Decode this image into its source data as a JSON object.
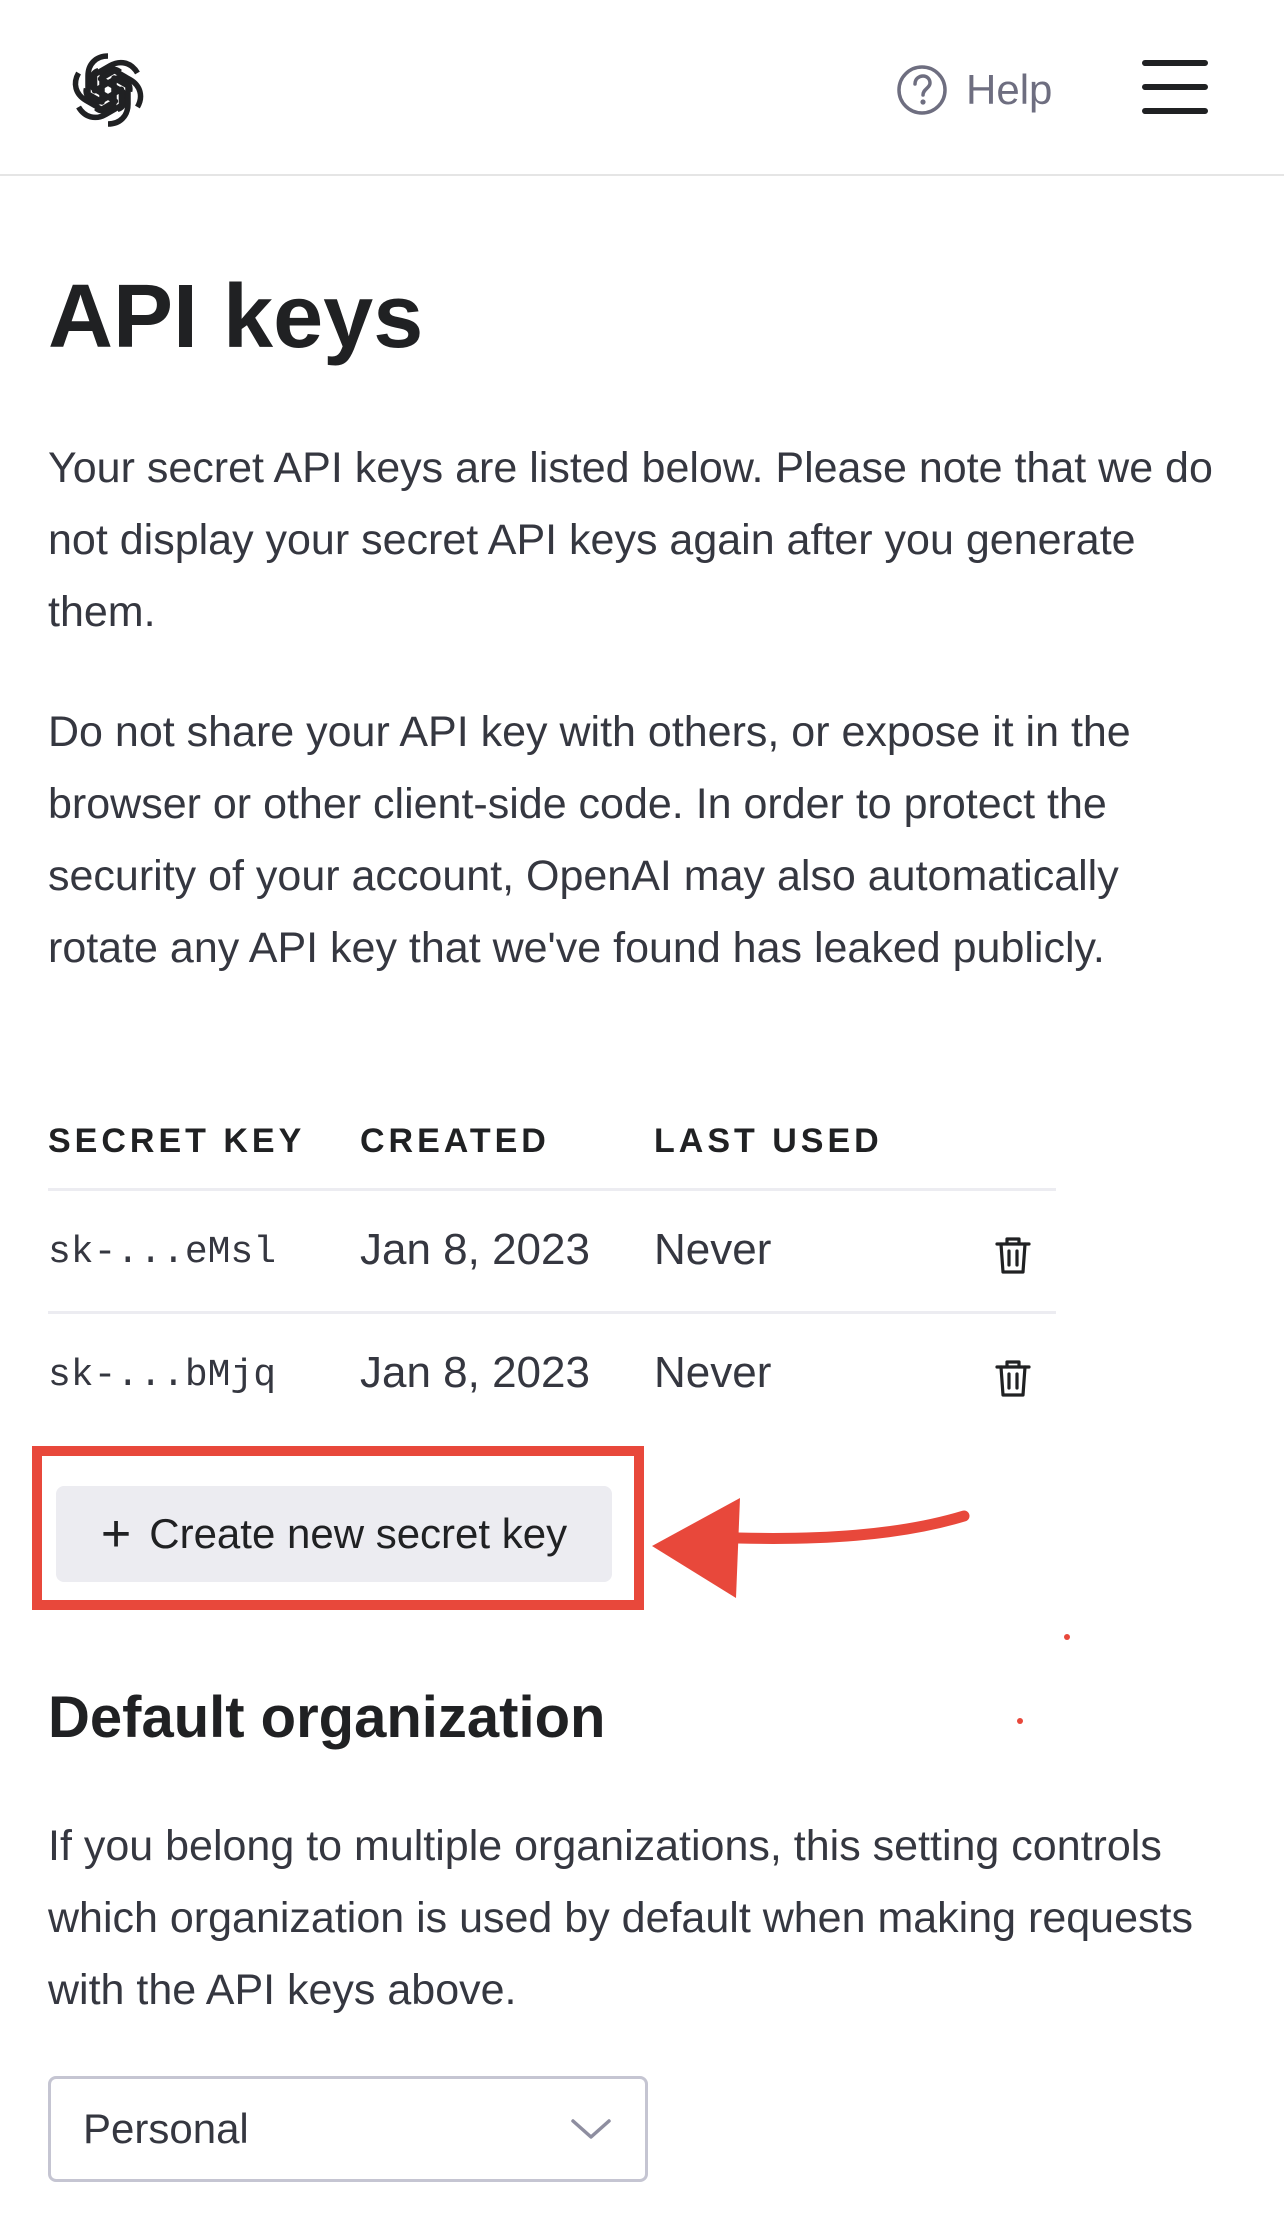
{
  "header": {
    "logo_icon": "openai-logo-icon",
    "help_label": "Help",
    "help_icon": "question-circle-icon",
    "menu_icon": "hamburger-menu-icon"
  },
  "main": {
    "title": "API keys",
    "intro": "Your secret API keys are listed below. Please note that we do not display your secret API keys again after you generate them.",
    "warning": "Do not share your API key with others, or expose it in the browser or other client-side code. In order to protect the security of your account, OpenAI may also automatically rotate any API key that we've found has leaked publicly."
  },
  "keys_table": {
    "headers": {
      "secret_key": "SECRET KEY",
      "created": "CREATED",
      "last_used": "LAST USED"
    },
    "rows": [
      {
        "key": "sk-...eMsl",
        "created": "Jan 8, 2023",
        "last_used": "Never"
      },
      {
        "key": "sk-...bMjq",
        "created": "Jan 8, 2023",
        "last_used": "Never"
      }
    ]
  },
  "create_button": {
    "icon": "+",
    "label": "Create new secret key"
  },
  "annotation": {
    "highlight_color": "#e8483b"
  },
  "organization": {
    "title": "Default organization",
    "description": "If you belong to multiple organizations, this setting controls which organization is used by default when making requests with the API keys above.",
    "selected": "Personal"
  },
  "colors": {
    "text": "#202123",
    "muted": "#6e6e80",
    "button_bg": "#ececf1",
    "accent_red": "#e8483b"
  }
}
